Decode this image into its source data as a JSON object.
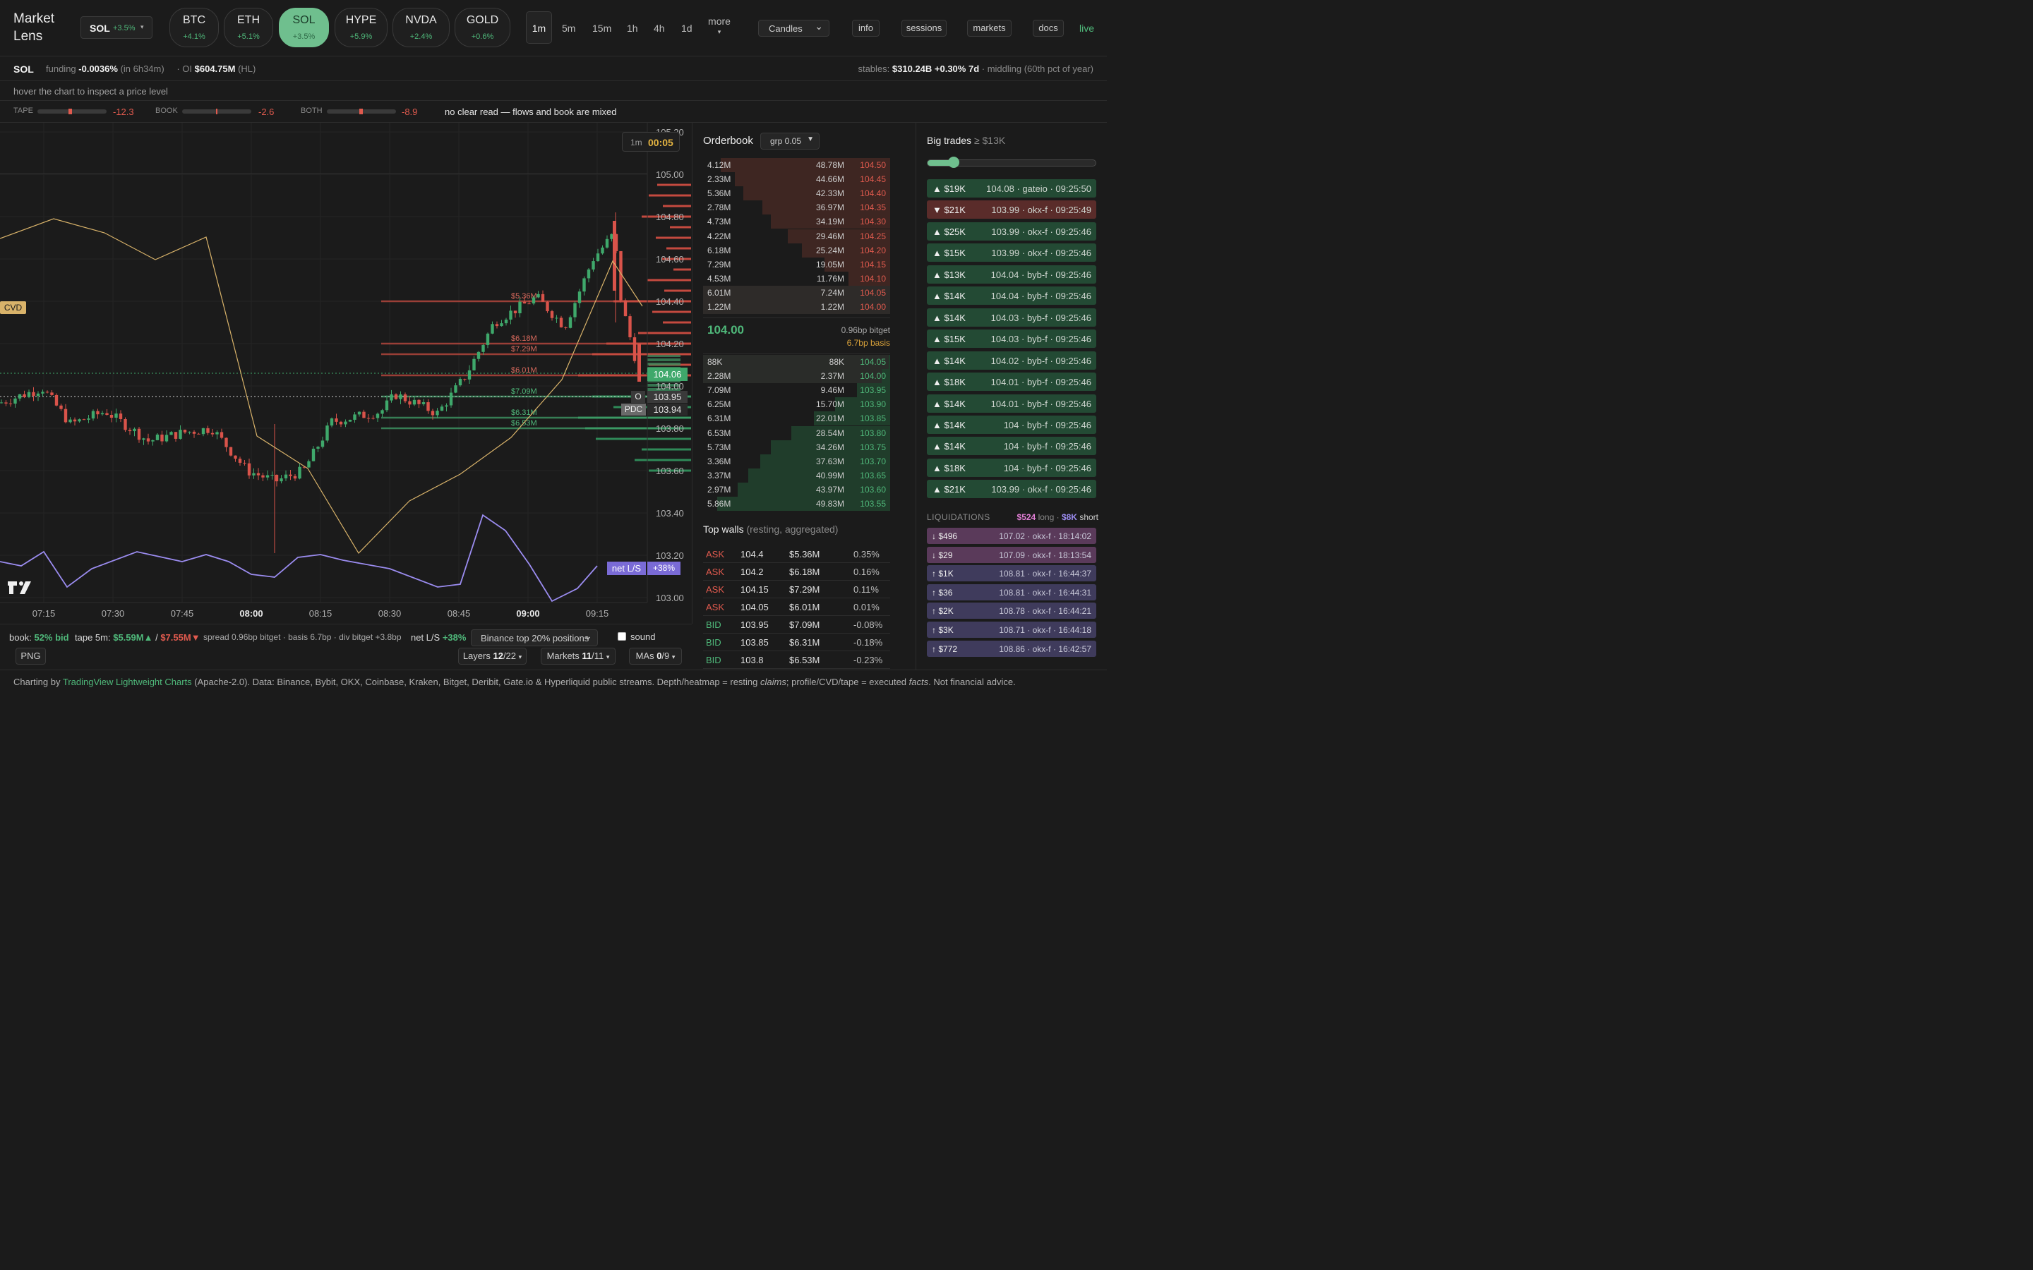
{
  "brand": {
    "line1": "Market",
    "line2": "Lens"
  },
  "symbol_select": {
    "symbol": "SOL",
    "change": "+3.5%",
    "caret": "▾"
  },
  "pills": [
    {
      "name": "BTC",
      "change": "+4.1%",
      "active": false
    },
    {
      "name": "ETH",
      "change": "+5.1%",
      "active": false
    },
    {
      "name": "SOL",
      "change": "+3.5%",
      "active": true
    },
    {
      "name": "HYPE",
      "change": "+5.9%",
      "active": false
    },
    {
      "name": "NVDA",
      "change": "+2.4%",
      "active": false
    },
    {
      "name": "GOLD",
      "change": "+0.6%",
      "active": false
    }
  ],
  "timeframes": {
    "active": "1m",
    "items": [
      "5m",
      "15m",
      "1h",
      "4h",
      "1d"
    ],
    "more": "more",
    "more_caret": "▾"
  },
  "chart_type": {
    "value": "Candles",
    "caret": "⌄"
  },
  "top_buttons": {
    "info": "info",
    "sessions": "sessions",
    "markets": "markets",
    "docs": "docs",
    "live": "live"
  },
  "info_row": {
    "symbol": "SOL",
    "funding_label": "funding",
    "funding_value": "-0.0036%",
    "funding_eta": "(in 6h34m)",
    "oi_prefix": "· OI",
    "oi_value": "$604.75M",
    "oi_source": "(HL)",
    "stables_label": "stables:",
    "stables_value": "$310.24B +0.30% 7d",
    "stables_note": "· middling (60th pct of year)"
  },
  "hint": "hover the chart to inspect a price level",
  "signals": {
    "tape_label": "TAPE",
    "tape_value": "-12.3",
    "book_label": "BOOK",
    "book_value": "-2.6",
    "both_label": "BOTH",
    "both_value": "-8.9",
    "summary": "no clear read — flows and book are mixed"
  },
  "chart_overlay": {
    "timer_tf": "1m",
    "timer": "00:05",
    "cvd": "CVD",
    "current_price": "104.06",
    "open_tag": "O",
    "open_price": "103.95",
    "pdc_tag": "PDC",
    "pdc_price": "103.94",
    "netls_tag": "net L/S",
    "netls_value": "+38%",
    "logo": "TV"
  },
  "chart_data": {
    "type": "candlestick",
    "price_ticks": [
      "105.20",
      "105.00",
      "104.80",
      "104.60",
      "104.40",
      "104.20",
      "104.00",
      "103.80",
      "103.60",
      "103.40",
      "103.20",
      "103.00"
    ],
    "time_ticks": [
      "07:15",
      "07:30",
      "07:45",
      "08:00",
      "08:15",
      "08:30",
      "08:45",
      "09:00",
      "09:15"
    ],
    "wall_labels": [
      {
        "label": "$5.36M",
        "price": 104.4,
        "side": "ask"
      },
      {
        "label": "$6.18M",
        "price": 104.2,
        "side": "ask"
      },
      {
        "label": "$7.29M",
        "price": 104.15,
        "side": "ask"
      },
      {
        "label": "$6.01M",
        "price": 104.05,
        "side": "ask"
      },
      {
        "label": "$7.09M",
        "price": 103.95,
        "side": "bid"
      },
      {
        "label": "$6.31M",
        "price": 103.85,
        "side": "bid"
      },
      {
        "label": "$6.53M",
        "price": 103.8,
        "side": "bid"
      }
    ]
  },
  "orderbook": {
    "title": "Orderbook",
    "group": "grp 0.05",
    "asks": [
      {
        "size": "4.12M",
        "cum": "48.78M",
        "price": "104.50",
        "depth": 0.98
      },
      {
        "size": "2.33M",
        "cum": "44.66M",
        "price": "104.45",
        "depth": 0.9
      },
      {
        "size": "5.36M",
        "cum": "42.33M",
        "price": "104.40",
        "depth": 0.85
      },
      {
        "size": "2.78M",
        "cum": "36.97M",
        "price": "104.35",
        "depth": 0.74
      },
      {
        "size": "4.73M",
        "cum": "34.19M",
        "price": "104.30",
        "depth": 0.69
      },
      {
        "size": "4.22M",
        "cum": "29.46M",
        "price": "104.25",
        "depth": 0.59
      },
      {
        "size": "6.18M",
        "cum": "25.24M",
        "price": "104.20",
        "depth": 0.51
      },
      {
        "size": "7.29M",
        "cum": "19.05M",
        "price": "104.15",
        "depth": 0.38
      },
      {
        "size": "4.53M",
        "cum": "11.76M",
        "price": "104.10",
        "depth": 0.24
      },
      {
        "size": "6.01M",
        "cum": "7.24M",
        "price": "104.05",
        "depth": 0.15
      },
      {
        "size": "1.22M",
        "cum": "1.22M",
        "price": "104.00",
        "depth": 0.03
      }
    ],
    "mid": {
      "price": "104.00",
      "spread": "0.96bp bitget",
      "basis": "6.7bp basis"
    },
    "bids": [
      {
        "size": "88K",
        "cum": "88K",
        "price": "104.05",
        "depth": 0.01
      },
      {
        "size": "2.28M",
        "cum": "2.37M",
        "price": "104.00",
        "depth": 0.05
      },
      {
        "size": "7.09M",
        "cum": "9.46M",
        "price": "103.95",
        "depth": 0.19
      },
      {
        "size": "6.25M",
        "cum": "15.70M",
        "price": "103.90",
        "depth": 0.32
      },
      {
        "size": "6.31M",
        "cum": "22.01M",
        "price": "103.85",
        "depth": 0.44
      },
      {
        "size": "6.53M",
        "cum": "28.54M",
        "price": "103.80",
        "depth": 0.57
      },
      {
        "size": "5.73M",
        "cum": "34.26M",
        "price": "103.75",
        "depth": 0.69
      },
      {
        "size": "3.36M",
        "cum": "37.63M",
        "price": "103.70",
        "depth": 0.75
      },
      {
        "size": "3.37M",
        "cum": "40.99M",
        "price": "103.65",
        "depth": 0.82
      },
      {
        "size": "2.97M",
        "cum": "43.97M",
        "price": "103.60",
        "depth": 0.88
      },
      {
        "size": "5.86M",
        "cum": "49.83M",
        "price": "103.55",
        "depth": 1.0
      }
    ]
  },
  "top_walls": {
    "title": "Top walls",
    "subtitle": "(resting, aggregated)",
    "rows": [
      {
        "side": "ASK",
        "price": "104.4",
        "size": "$5.36M",
        "dist": "0.35%"
      },
      {
        "side": "ASK",
        "price": "104.2",
        "size": "$6.18M",
        "dist": "0.16%"
      },
      {
        "side": "ASK",
        "price": "104.15",
        "size": "$7.29M",
        "dist": "0.11%"
      },
      {
        "side": "ASK",
        "price": "104.05",
        "size": "$6.01M",
        "dist": "0.01%"
      },
      {
        "side": "BID",
        "price": "103.95",
        "size": "$7.09M",
        "dist": "-0.08%"
      },
      {
        "side": "BID",
        "price": "103.85",
        "size": "$6.31M",
        "dist": "-0.18%"
      },
      {
        "side": "BID",
        "price": "103.8",
        "size": "$6.53M",
        "dist": "-0.23%"
      }
    ]
  },
  "big_trades": {
    "title": "Big trades",
    "threshold": "≥ $13K",
    "slider_value": 0.12,
    "rows": [
      {
        "dir": "▲",
        "amount": "$19K",
        "detail": "104.08 · gateio · 09:25:50",
        "side": "buy"
      },
      {
        "dir": "▼",
        "amount": "$21K",
        "detail": "103.99 · okx-f · 09:25:49",
        "side": "sell"
      },
      {
        "dir": "▲",
        "amount": "$25K",
        "detail": "103.99 · okx-f · 09:25:46",
        "side": "buy"
      },
      {
        "dir": "▲",
        "amount": "$15K",
        "detail": "103.99 · okx-f · 09:25:46",
        "side": "buy"
      },
      {
        "dir": "▲",
        "amount": "$13K",
        "detail": "104.04 · byb-f · 09:25:46",
        "side": "buy"
      },
      {
        "dir": "▲",
        "amount": "$14K",
        "detail": "104.04 · byb-f · 09:25:46",
        "side": "buy"
      },
      {
        "dir": "▲",
        "amount": "$14K",
        "detail": "104.03 · byb-f · 09:25:46",
        "side": "buy"
      },
      {
        "dir": "▲",
        "amount": "$15K",
        "detail": "104.03 · byb-f · 09:25:46",
        "side": "buy"
      },
      {
        "dir": "▲",
        "amount": "$14K",
        "detail": "104.02 · byb-f · 09:25:46",
        "side": "buy"
      },
      {
        "dir": "▲",
        "amount": "$18K",
        "detail": "104.01 · byb-f · 09:25:46",
        "side": "buy"
      },
      {
        "dir": "▲",
        "amount": "$14K",
        "detail": "104.01 · byb-f · 09:25:46",
        "side": "buy"
      },
      {
        "dir": "▲",
        "amount": "$14K",
        "detail": "104 · byb-f · 09:25:46",
        "side": "buy"
      },
      {
        "dir": "▲",
        "amount": "$14K",
        "detail": "104 · byb-f · 09:25:46",
        "side": "buy"
      },
      {
        "dir": "▲",
        "amount": "$18K",
        "detail": "104 · byb-f · 09:25:46",
        "side": "buy"
      },
      {
        "dir": "▲",
        "amount": "$21K",
        "detail": "103.99 · okx-f · 09:25:46",
        "side": "buy"
      }
    ]
  },
  "liquidations": {
    "title": "LIQUIDATIONS",
    "long_amount": "$524",
    "long_label": "long ·",
    "short_amount": "$8K",
    "short_label": "short",
    "rows": [
      {
        "dir": "↓",
        "amount": "$496",
        "detail": "107.02 · okx-f · 18:14:02",
        "side": "long"
      },
      {
        "dir": "↓",
        "amount": "$29",
        "detail": "107.09 · okx-f · 18:13:54",
        "side": "long"
      },
      {
        "dir": "↑",
        "amount": "$1K",
        "detail": "108.81 · okx-f · 16:44:37",
        "side": "short"
      },
      {
        "dir": "↑",
        "amount": "$36",
        "detail": "108.81 · okx-f · 16:44:31",
        "side": "short"
      },
      {
        "dir": "↑",
        "amount": "$2K",
        "detail": "108.78 · okx-f · 16:44:21",
        "side": "short"
      },
      {
        "dir": "↑",
        "amount": "$3K",
        "detail": "108.71 · okx-f · 16:44:18",
        "side": "short"
      },
      {
        "dir": "↑",
        "amount": "$772",
        "detail": "108.86 · okx-f · 16:42:57",
        "side": "short"
      }
    ]
  },
  "status": {
    "book_label": "book:",
    "book_value": "52% bid",
    "tape_label": "tape 5m:",
    "tape_buy": "$5.59M▲",
    "tape_sep": "/",
    "tape_sell": "$7.55M▼",
    "spread": "spread 0.96bp bitget · basis 6.7bp · div bitget +3.8bp",
    "netls_label": "net L/S",
    "netls_value": "+38%",
    "positions": "Binance top 20% positions",
    "sound": "sound",
    "png": "PNG",
    "layers_label": "Layers",
    "layers_value": "12",
    "layers_total": "/22",
    "markets_label": "Markets",
    "markets_value": "11",
    "markets_total": "/11",
    "mas_label": "MAs",
    "mas_value": "0",
    "mas_total": "/9",
    "caret": "▾"
  },
  "footer": {
    "prefix": "Charting by ",
    "link": "TradingView Lightweight Charts",
    "rest_a": " (Apache-2.0). Data: Binance, Bybit, OKX, Coinbase, Kraken, Bitget, Deribit, Gate.io & Hyperliquid public streams. Depth/heatmap = resting ",
    "claims": "claims",
    "rest_b": "; profile/CVD/tape = executed ",
    "facts": "facts",
    "rest_c": ". Not financial advice."
  },
  "colors": {
    "up": "#4fb87a",
    "down": "#e05a4e",
    "accent": "#6fbf8e",
    "cvd": "#d9b36a",
    "netls": "#9b8cf0"
  }
}
